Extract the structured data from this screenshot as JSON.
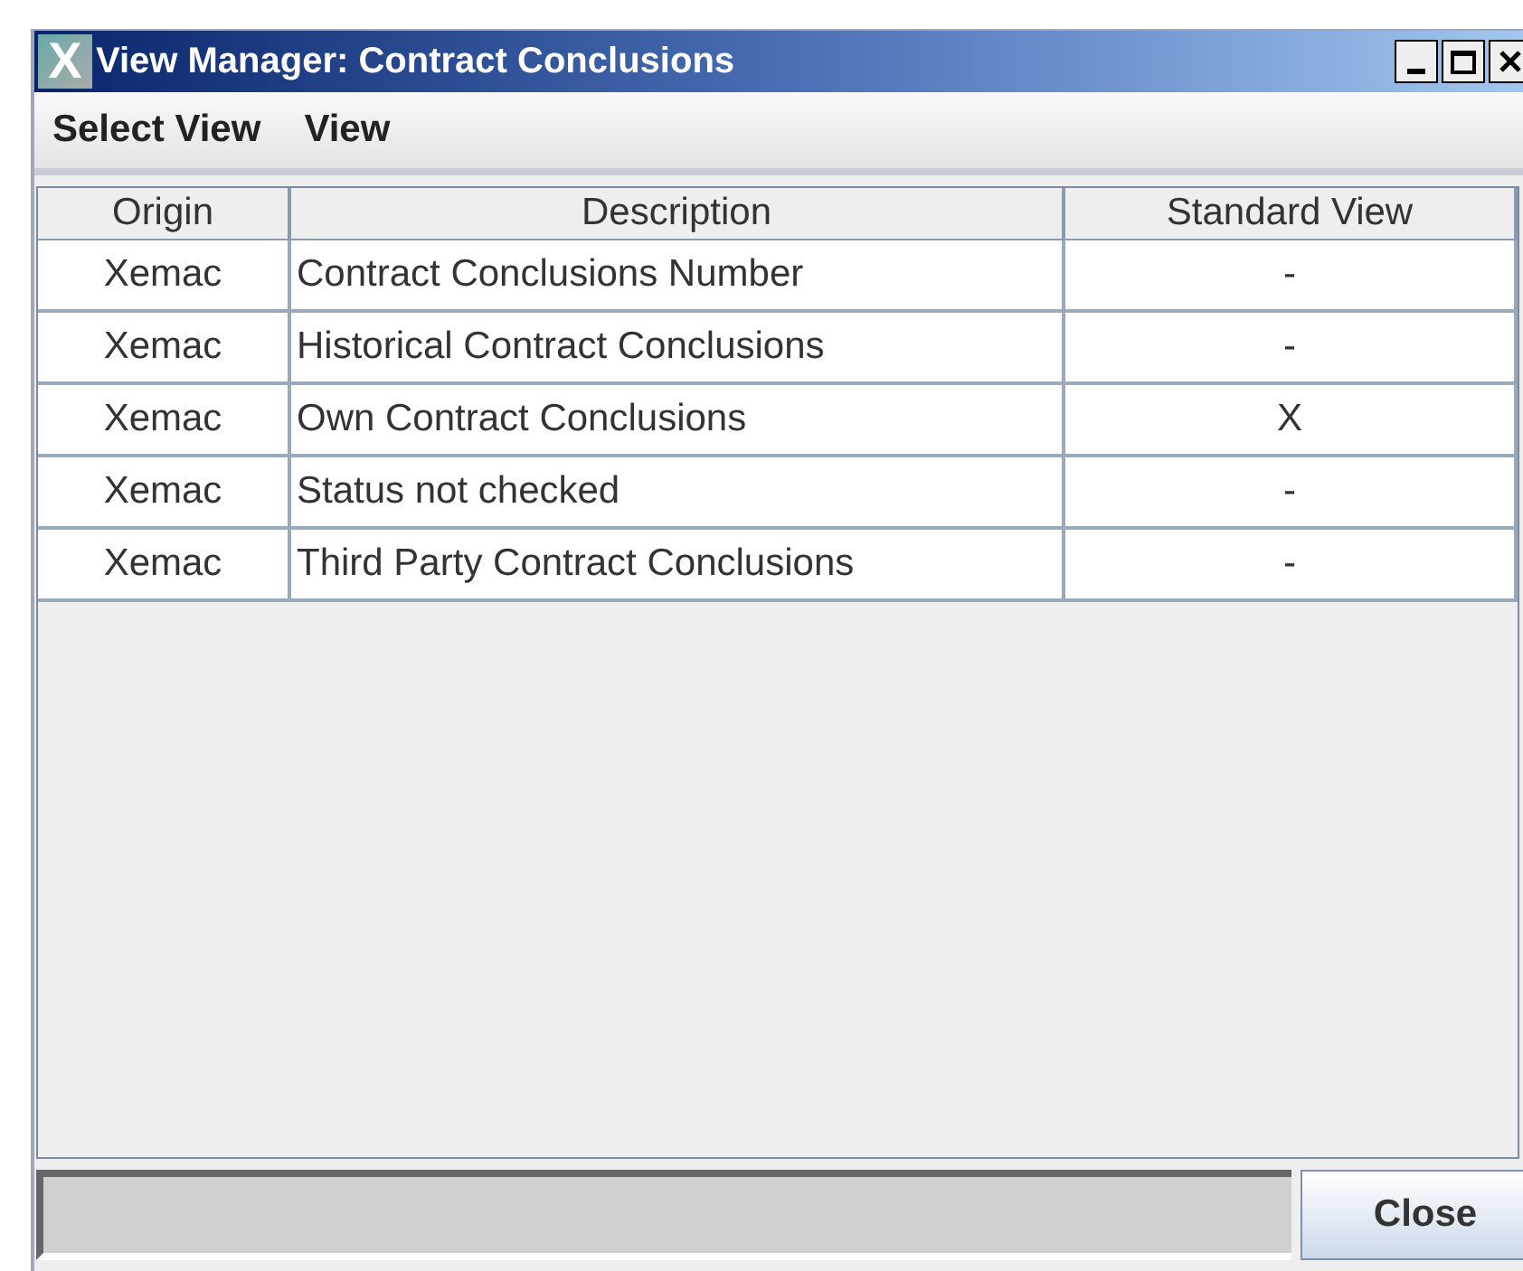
{
  "window": {
    "title": "View Manager: Contract Conclusions",
    "logo": "X"
  },
  "menu": [
    "Select View",
    "View"
  ],
  "table": {
    "columns": [
      "Origin",
      "Description",
      "Standard View"
    ],
    "rows": [
      {
        "cells": [
          "Xemac",
          "Contract Conclusions Number",
          "-"
        ]
      },
      {
        "cells": [
          "Xemac",
          "Historical Contract Conclusions",
          "-"
        ]
      },
      {
        "cells": [
          "Xemac",
          "Own Contract Conclusions",
          "X"
        ]
      },
      {
        "cells": [
          "Xemac",
          "Status not checked",
          "-"
        ]
      },
      {
        "cells": [
          "Xemac",
          "Third Party Contract Conclusions",
          "-"
        ]
      }
    ]
  },
  "buttons": [
    "Close"
  ]
}
